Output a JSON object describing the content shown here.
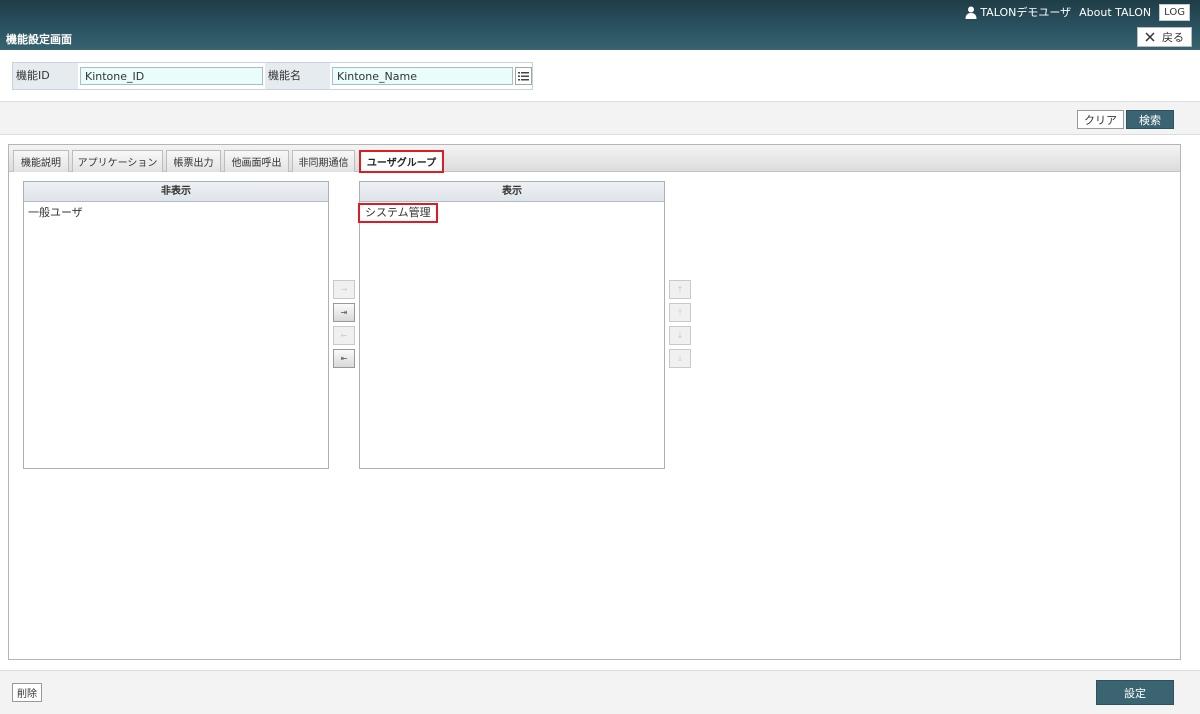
{
  "header": {
    "user_name": "TALONデモユーザ",
    "about": "About TALON",
    "log_label": "LOG",
    "page_title": "機能設定画面",
    "back_label": "戻る"
  },
  "search": {
    "id_label": "機能ID",
    "id_value": "Kintone_ID",
    "name_label": "機能名",
    "name_value": "Kintone_Name"
  },
  "actions": {
    "clear_label": "クリア",
    "search_label": "検索"
  },
  "tabs": [
    {
      "label": "機能説明",
      "active": false
    },
    {
      "label": "アプリケーション",
      "active": false
    },
    {
      "label": "帳票出力",
      "active": false
    },
    {
      "label": "他画面呼出",
      "active": false
    },
    {
      "label": "非同期通信",
      "active": false
    },
    {
      "label": "ユーザグループ",
      "active": true
    }
  ],
  "hidden_list": {
    "header": "非表示",
    "items": [
      "一般ユーザ"
    ]
  },
  "shown_list": {
    "header": "表示",
    "items": [
      "システム管理"
    ]
  },
  "move_buttons": [
    {
      "glyph": "→",
      "enabled": false
    },
    {
      "glyph": "⇥",
      "enabled": true
    },
    {
      "glyph": "←",
      "enabled": false
    },
    {
      "glyph": "⇤",
      "enabled": true
    }
  ],
  "order_buttons": [
    {
      "glyph": "↑",
      "enabled": false
    },
    {
      "glyph": "⤒",
      "enabled": false
    },
    {
      "glyph": "↓",
      "enabled": false
    },
    {
      "glyph": "⤓",
      "enabled": false
    }
  ],
  "footer": {
    "delete_label": "削除",
    "set_label": "設定"
  },
  "colors": {
    "header_dark": "#1f3d46",
    "primary_button": "#3a6472",
    "input_bg": "#e9fdfd",
    "highlight_red": "#dd1c24"
  }
}
